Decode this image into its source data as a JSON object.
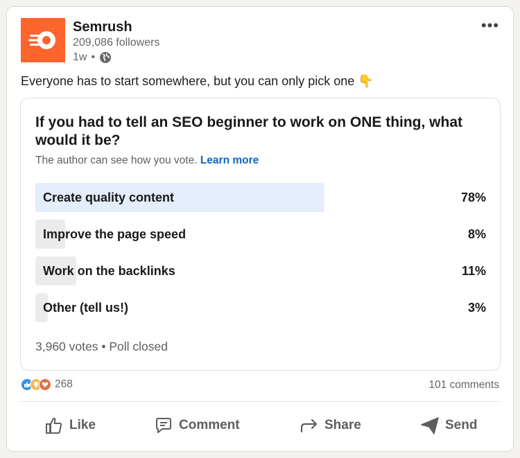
{
  "post": {
    "author": "Semrush",
    "followers": "209,086 followers",
    "time": "1w",
    "dot": "•",
    "more_label": "•••",
    "text": "Everyone has to start somewhere, but you can only pick one 👇"
  },
  "poll": {
    "question": "If you had to tell an SEO beginner to work on ONE thing, what would it be?",
    "note": "The author can see how you vote.",
    "learn_more": "Learn more",
    "options": [
      {
        "label": "Create quality content",
        "percent": "78%",
        "share": 0.78
      },
      {
        "label": "Improve the page speed",
        "percent": "8%",
        "share": 0.08
      },
      {
        "label": "Work on the backlinks",
        "percent": "11%",
        "share": 0.11
      },
      {
        "label": "Other (tell us!)",
        "percent": "3%",
        "share": 0.03
      }
    ],
    "votes": "3,960 votes",
    "status": "Poll closed"
  },
  "social": {
    "reaction_count": "268",
    "comments": "101 comments",
    "reaction_icons": [
      "like-icon",
      "insightful-icon",
      "love-icon"
    ]
  },
  "actions": {
    "like": "Like",
    "comment": "Comment",
    "share": "Share",
    "send": "Send"
  },
  "colors": {
    "brand": "#ff642d",
    "leading_option": "#e3edfb",
    "option": "#ebebeb",
    "link": "#0a66c2"
  }
}
